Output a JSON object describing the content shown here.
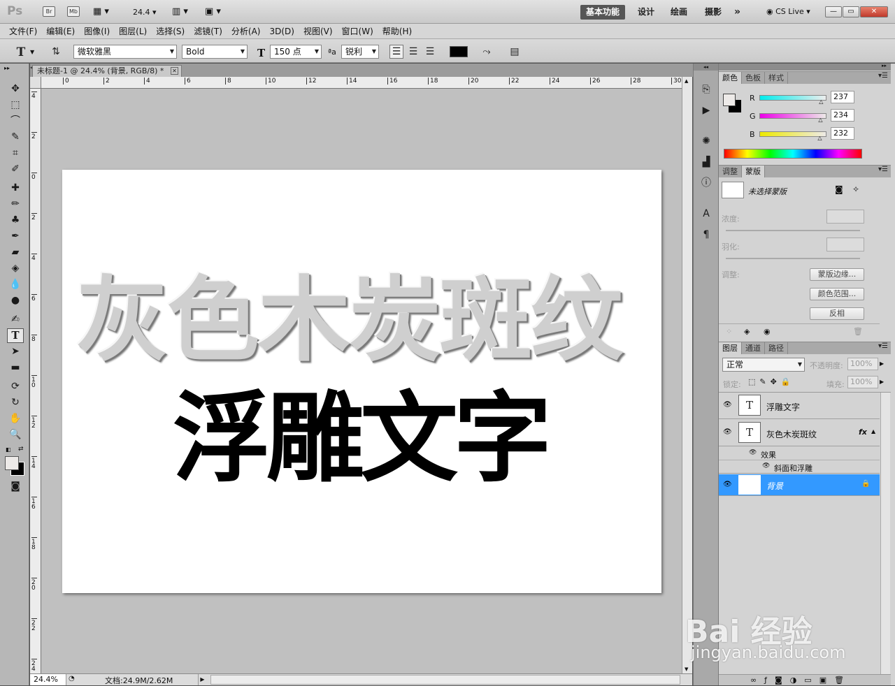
{
  "appbar": {
    "logo": "Ps",
    "bridge": "Br",
    "minibridge": "Mb",
    "zoom": "24.4",
    "workspaces": [
      "基本功能",
      "设计",
      "绘画",
      "摄影"
    ],
    "more": "»",
    "cslive": "CS Live",
    "win": [
      "—",
      "▭",
      "✕"
    ]
  },
  "menu": [
    "文件(F)",
    "编辑(E)",
    "图像(I)",
    "图层(L)",
    "选择(S)",
    "滤镜(T)",
    "分析(A)",
    "3D(D)",
    "视图(V)",
    "窗口(W)",
    "帮助(H)"
  ],
  "options": {
    "font_family": "微软雅黑",
    "font_style": "Bold",
    "font_size": "150 点",
    "aa_label": "ªa",
    "antialias": "锐利",
    "text_color": "#000000"
  },
  "document": {
    "tab_title": "未标题-1 @ 24.4% (背景, RGB/8) *",
    "title_text": "灰色木炭斑纹",
    "subtitle_text": "浮雕文字",
    "ruler_top": [
      "0",
      "2",
      "4",
      "6",
      "8",
      "10",
      "12",
      "14",
      "16",
      "18",
      "20",
      "22",
      "24",
      "26",
      "28",
      "30"
    ],
    "ruler_left": [
      "4",
      "2",
      "0",
      "2",
      "4",
      "6",
      "8",
      "10",
      "12",
      "14",
      "16",
      "18",
      "20",
      "22",
      "24"
    ]
  },
  "status": {
    "zoom": "24.4%",
    "doc_info": "文档:24.9M/2.62M"
  },
  "color_panel": {
    "tabs": [
      "颜色",
      "色板",
      "样式"
    ],
    "r_label": "R",
    "g_label": "G",
    "b_label": "B",
    "r": "237",
    "g": "234",
    "b": "232",
    "r_fraction": 0.93,
    "g_fraction": 0.92,
    "b_fraction": 0.91
  },
  "mask_panel": {
    "tabs": [
      "调整",
      "蒙版"
    ],
    "no_mask": "未选择蒙版",
    "density": "浓度:",
    "feather": "羽化:",
    "adjust": "调整:",
    "buttons": [
      "蒙版边缘...",
      "颜色范围...",
      "反相"
    ]
  },
  "layers_panel": {
    "tabs": [
      "图层",
      "通道",
      "路径"
    ],
    "blend_mode": "正常",
    "opacity_label": "不透明度:",
    "opacity": "100%",
    "lock_label": "锁定:",
    "fill_label": "填充:",
    "fill": "100%",
    "layers": [
      {
        "name": "浮雕文字",
        "thumb": "T"
      },
      {
        "name": "灰色木炭斑纹",
        "thumb": "T",
        "fx": "fx"
      },
      {
        "name": "背景",
        "thumb": ""
      }
    ],
    "effects_label": "效果",
    "effect": "斜面和浮雕"
  },
  "colors": {
    "accent": "#3399ff",
    "workspace_active": "#565656"
  },
  "watermark": {
    "brand": "Bai 经验",
    "url": "jingyan.baidu.com"
  }
}
